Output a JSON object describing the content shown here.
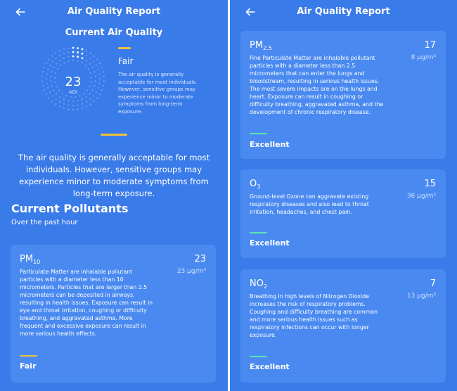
{
  "colors": {
    "background": "#3a7bea",
    "card": "#4a8af0",
    "fair": "#f0c239",
    "excellent": "#5fe0b4"
  },
  "screens": {
    "left": {
      "title": "Air Quality Report",
      "back_icon": "arrow-left-icon",
      "current": {
        "section_title": "Current Air Quality",
        "aqi_value": "23",
        "aqi_label": "AQI",
        "status": "Fair",
        "status_description": "The air quality is generally acceptable for most individuals. However, sensitive groups may experience minor to moderate symptoms from long-term exposure.",
        "long_description": "The air quality is generally acceptable for most individuals. However, sensitive groups may experience minor to moderate symptoms from long-term exposure."
      },
      "pollutants_title": "Current Pollutants",
      "pollutants_subtitle": "Over the past hour",
      "cards": [
        {
          "name": "PM",
          "sub": "10",
          "value": "23",
          "concentration": "23 µg/m³",
          "description": "Particulate Matter are inhalable pollutant particles with a diameter less than 10 micrometers. Particles that are larger than 2.5 micrometers can be deposited in airways, resulting in health issues. Exposure can result in eye and throat irritation, coughing or difficulty breathing, and aggravated asthma. More frequent and excessive exposure can result in more serious health effects.",
          "rating": "Fair"
        }
      ]
    },
    "right": {
      "title": "Air Quality Report",
      "back_icon": "arrow-left-icon",
      "cards": [
        {
          "name": "PM",
          "sub": "2.5",
          "value": "17",
          "concentration": "8 µg/m³",
          "description": "Fine Particulate Matter are inhalable pollutant particles with a diameter less than 2.5 micrometers that can enter the lungs and bloodstream, resulting in serious health issues. The most severe impacts are on the lungs and heart. Exposure can result in coughing or difficulty breathing, aggravated asthma, and the development of chronic respiratory disease.",
          "rating": "Excellent"
        },
        {
          "name": "O",
          "sub": "3",
          "value": "15",
          "concentration": "36 µg/m³",
          "description": "Ground-level Ozone can aggravate existing respiratory diseases and also lead to throat irritation, headaches, and chest pain.",
          "rating": "Excellent"
        },
        {
          "name": "NO",
          "sub": "2",
          "value": "7",
          "concentration": "13 µg/m³",
          "description": "Breathing in high levels of Nitrogen Dioxide increases the risk of respiratory problems. Coughing and difficulty breathing are common and more serious health issues such as respiratory infections can occur with longer exposure.",
          "rating": "Excellent"
        }
      ]
    }
  }
}
